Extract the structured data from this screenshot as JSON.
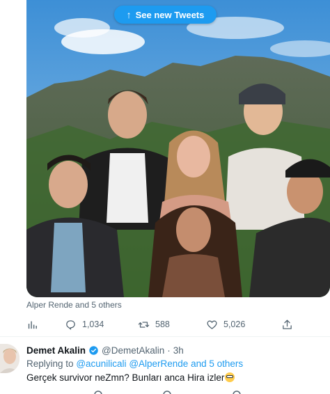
{
  "banner": {
    "label": "See new Tweets",
    "icon": "arrow-up-icon"
  },
  "media": {
    "tag_line": "Alper Rende and 5 others"
  },
  "actions": {
    "analytics": {
      "icon": "analytics-icon"
    },
    "reply": {
      "icon": "reply-icon",
      "count": "1,034"
    },
    "retweet": {
      "icon": "retweet-icon",
      "count": "588"
    },
    "like": {
      "icon": "heart-icon",
      "count": "5,026"
    },
    "share": {
      "icon": "share-icon"
    }
  },
  "reply_tweet": {
    "name": "Demet Akalin",
    "handle": "@DemetAkalin",
    "separator": "·",
    "time": "3h",
    "replying_prefix": "Replying to",
    "mention_1": "@acunilicali",
    "mention_2": "@AlperRende",
    "and_others": "and 5 others",
    "text": "Gerçek survivor neZmn? Bunları anca Hira izler"
  },
  "colors": {
    "accent": "#1d9bf0",
    "secondary_text": "#536471",
    "primary_text": "#0f1419"
  }
}
